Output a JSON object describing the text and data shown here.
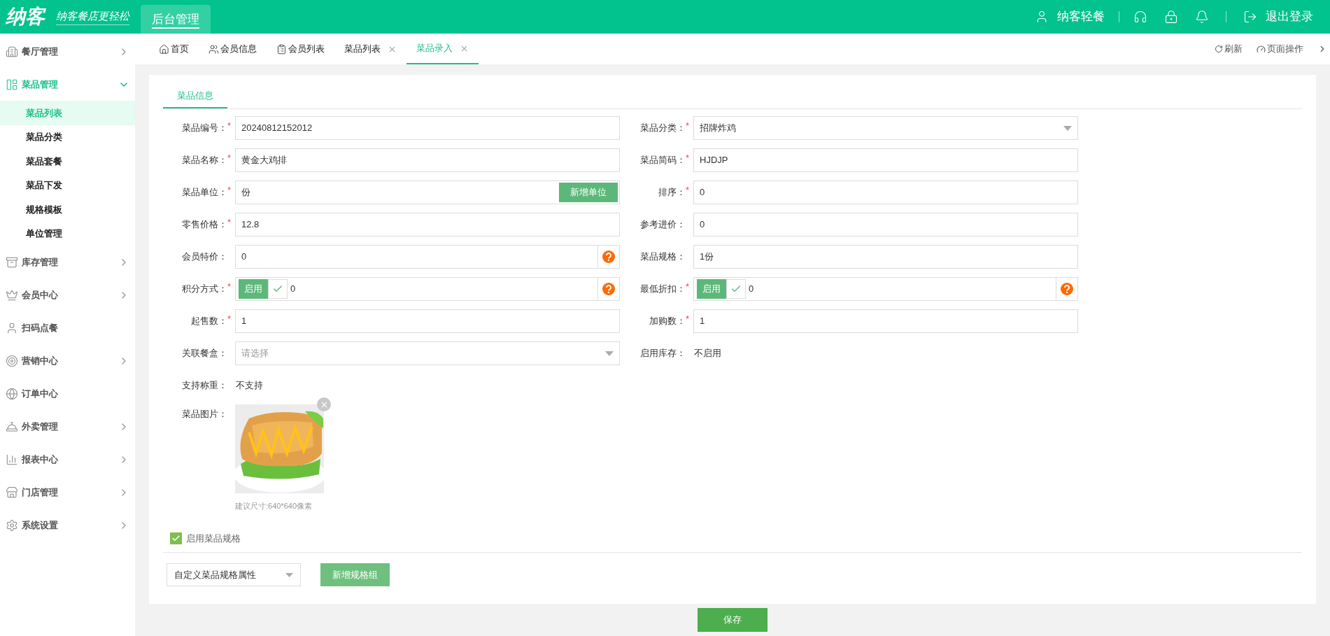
{
  "header": {
    "logo": "纳客",
    "slogan": "纳客餐店更轻松",
    "nav": [
      {
        "label": "后台管理",
        "selected": true
      }
    ],
    "user": "纳客轻餐",
    "logout": "退出登录"
  },
  "sidebar": {
    "items": [
      {
        "label": "餐厅管理",
        "expandable": true,
        "expanded": false
      },
      {
        "label": "菜品管理",
        "expandable": true,
        "expanded": true,
        "children": [
          {
            "label": "菜品列表",
            "selected": true
          },
          {
            "label": "菜品分类",
            "selected": false
          },
          {
            "label": "菜品套餐",
            "selected": false
          },
          {
            "label": "菜品下发",
            "selected": false
          },
          {
            "label": "规格模板",
            "selected": false
          },
          {
            "label": "单位管理",
            "selected": false
          }
        ]
      },
      {
        "label": "库存管理",
        "expandable": true,
        "expanded": false
      },
      {
        "label": "会员中心",
        "expandable": true,
        "expanded": false
      },
      {
        "label": "扫码点餐",
        "expandable": false,
        "expanded": false
      },
      {
        "label": "营销中心",
        "expandable": true,
        "expanded": false
      },
      {
        "label": "订单中心",
        "expandable": false,
        "expanded": false
      },
      {
        "label": "外卖管理",
        "expandable": true,
        "expanded": false
      },
      {
        "label": "报表中心",
        "expandable": true,
        "expanded": false
      },
      {
        "label": "门店管理",
        "expandable": true,
        "expanded": false
      },
      {
        "label": "系统设置",
        "expandable": true,
        "expanded": false
      }
    ]
  },
  "tabs": [
    {
      "label": "首页",
      "selected": false,
      "closable": false
    },
    {
      "label": "会员信息",
      "selected": false,
      "closable": false
    },
    {
      "label": "会员列表",
      "selected": false,
      "closable": false
    },
    {
      "label": "菜品列表",
      "selected": false,
      "closable": true
    },
    {
      "label": "菜品录入",
      "selected": true,
      "closable": true
    }
  ],
  "tab_actions": [
    "刷新",
    "页面操作"
  ],
  "section_tabs": [
    {
      "label": "菜品信息",
      "selected": true
    }
  ],
  "form_rows": [
    [
      {
        "label": "菜品编号：",
        "required_mark": "*",
        "kind": "input",
        "value": "20240812152012"
      },
      {
        "label": "菜品分类：",
        "required_mark": "*",
        "kind": "select",
        "value": "招牌炸鸡"
      }
    ],
    [
      {
        "label": "菜品名称：",
        "required_mark": "*",
        "kind": "input",
        "value": "黄金大鸡排"
      },
      {
        "label": "菜品简码：",
        "required_mark": "*",
        "kind": "input",
        "value": "HJDJP"
      }
    ],
    [
      {
        "label": "菜品单位：",
        "required_mark": "*",
        "kind": "input_button",
        "value": "份",
        "button": "新增单位"
      },
      {
        "label": "排序：",
        "required_mark": "*",
        "kind": "input",
        "value": "0"
      }
    ],
    [
      {
        "label": "零售价格：",
        "required_mark": "*",
        "kind": "input",
        "value": "12.8"
      },
      {
        "label": "参考进价：",
        "kind": "input",
        "value": "0"
      }
    ],
    [
      {
        "label": "会员特价：",
        "kind": "input_help",
        "value": "0"
      },
      {
        "label": "菜品规格：",
        "kind": "input",
        "value": "1份"
      }
    ],
    [
      {
        "label": "积分方式：",
        "required_mark": "*",
        "kind": "toggle_help",
        "toggle": {
          "label": "启用",
          "on": true
        },
        "value": "0"
      },
      {
        "label": "最低折扣：",
        "required_mark": "*",
        "kind": "toggle_help",
        "toggle": {
          "label": "启用",
          "on": true
        },
        "value": "0"
      }
    ],
    [
      {
        "label": "起售数：",
        "required_mark": "*",
        "kind": "input",
        "value": "1"
      },
      {
        "label": "加购数：",
        "required_mark": "*",
        "kind": "input",
        "value": "1"
      }
    ],
    [
      {
        "label": "关联餐盒：",
        "kind": "select",
        "placeholder": "请选择"
      },
      {
        "label": "启用库存：",
        "kind": "text",
        "value": "不启用"
      }
    ],
    [
      {
        "label": "支持称重：",
        "kind": "text",
        "value": "不支持"
      }
    ]
  ],
  "image_field": {
    "label": "菜品图片：",
    "hint": "建议尺寸:640*640像素"
  },
  "spec": {
    "checkbox": {
      "label": "启用菜品规格",
      "checked": true
    },
    "select": "自定义菜品规格属性",
    "button": "新增规格组"
  },
  "save_button": "保存"
}
